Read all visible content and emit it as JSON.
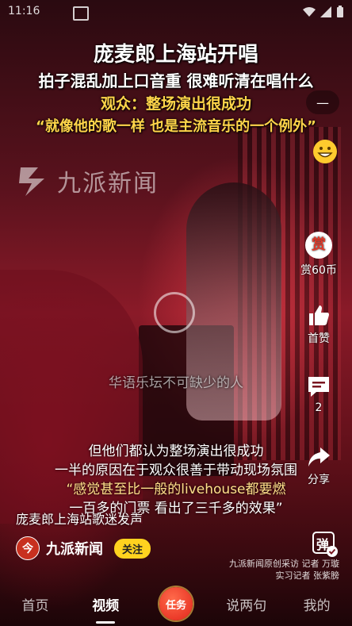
{
  "status_bar": {
    "time": "11:16"
  },
  "headline": {
    "line1": "庞麦郎上海站开唱",
    "line2": "拍子混乱加上口音重 很难听清在唱什么",
    "line3": "观众：整场演出很成功",
    "line4": "“就像他的歌一样 也是主流音乐的一个例外”"
  },
  "watermark": {
    "text": "九派新闻"
  },
  "subtitles": {
    "mid": "华语乐坛不可缺少的人",
    "line1": "但他们都认为整场演出很成功",
    "line2": "一半的原因在于观众很善于带动现场氛围",
    "line3": "“感觉甚至比一般的livehouse都要燃",
    "line4": "一百多的门票 看出了三千多的效果”"
  },
  "right_rail": {
    "reward_label": "赏60币",
    "reward_icon_text": "赏",
    "like_label": "首赞",
    "comment_count": "2",
    "share_label": "分享",
    "top_pill_text": "—"
  },
  "caption": "庞麦郎上海站歌迷发声",
  "author": {
    "name": "九派新闻",
    "avatar_text": "今",
    "follow_label": "关注"
  },
  "danmu_icon_text": "弹",
  "credit": {
    "line1": "九派新闻原创采访 记者 万璇",
    "line2": "实习记者 张紫膀"
  },
  "tabs": [
    {
      "label": "首页"
    },
    {
      "label": "视频"
    },
    {
      "label": "任务"
    },
    {
      "label": "说两句"
    },
    {
      "label": "我的"
    }
  ],
  "colors": {
    "accent_yellow": "#ffd21f",
    "subtitle_yellow": "#ffd54a",
    "task_red": "#e2251b"
  }
}
